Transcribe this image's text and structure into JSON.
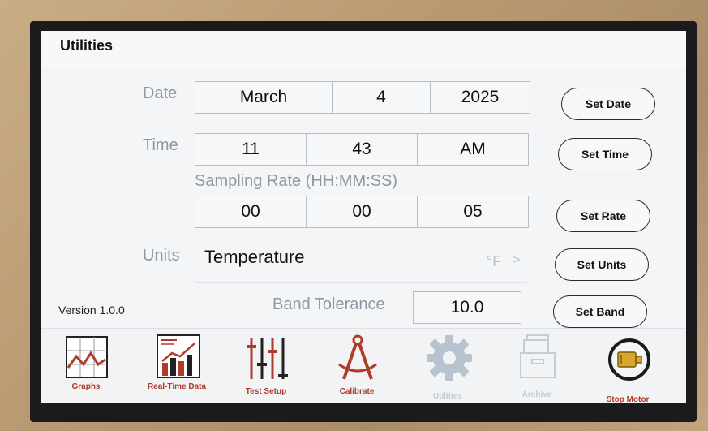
{
  "screen": {
    "title": "Utilities"
  },
  "date": {
    "label": "Date",
    "month": "March",
    "day": "4",
    "year": "2025",
    "button": "Set Date"
  },
  "time": {
    "label": "Time",
    "hour": "11",
    "minute": "43",
    "ampm": "AM",
    "button": "Set Time"
  },
  "sampling": {
    "label": "Sampling Rate (HH:MM:SS)",
    "hh": "00",
    "mm": "00",
    "ss": "05",
    "button": "Set Rate"
  },
  "units": {
    "label": "Units",
    "value": "Temperature",
    "unit": "°F",
    "chevron": ">",
    "button": "Set Units"
  },
  "band": {
    "label": "Band Tolerance",
    "value": "10.0",
    "button": "Set Band"
  },
  "version": "Version 1.0.0",
  "toolbar": {
    "items": [
      {
        "label": "Graphs",
        "icon": "graph-icon",
        "enabled": true
      },
      {
        "label": "Real-Time Data",
        "icon": "realtime-chart-icon",
        "enabled": true
      },
      {
        "label": "Test Setup",
        "icon": "sliders-icon",
        "enabled": true
      },
      {
        "label": "Calibrate",
        "icon": "compass-icon",
        "enabled": true
      },
      {
        "label": "Utilities",
        "icon": "gear-icon",
        "enabled": false
      },
      {
        "label": "Archive",
        "icon": "archive-icon",
        "enabled": false
      },
      {
        "label": "Stop Motor",
        "icon": "motor-icon",
        "enabled": true
      }
    ]
  },
  "colors": {
    "accent_red": "#b23a2a",
    "label_gray": "#8e98a3",
    "disabled_gray": "#c6ccd3"
  }
}
